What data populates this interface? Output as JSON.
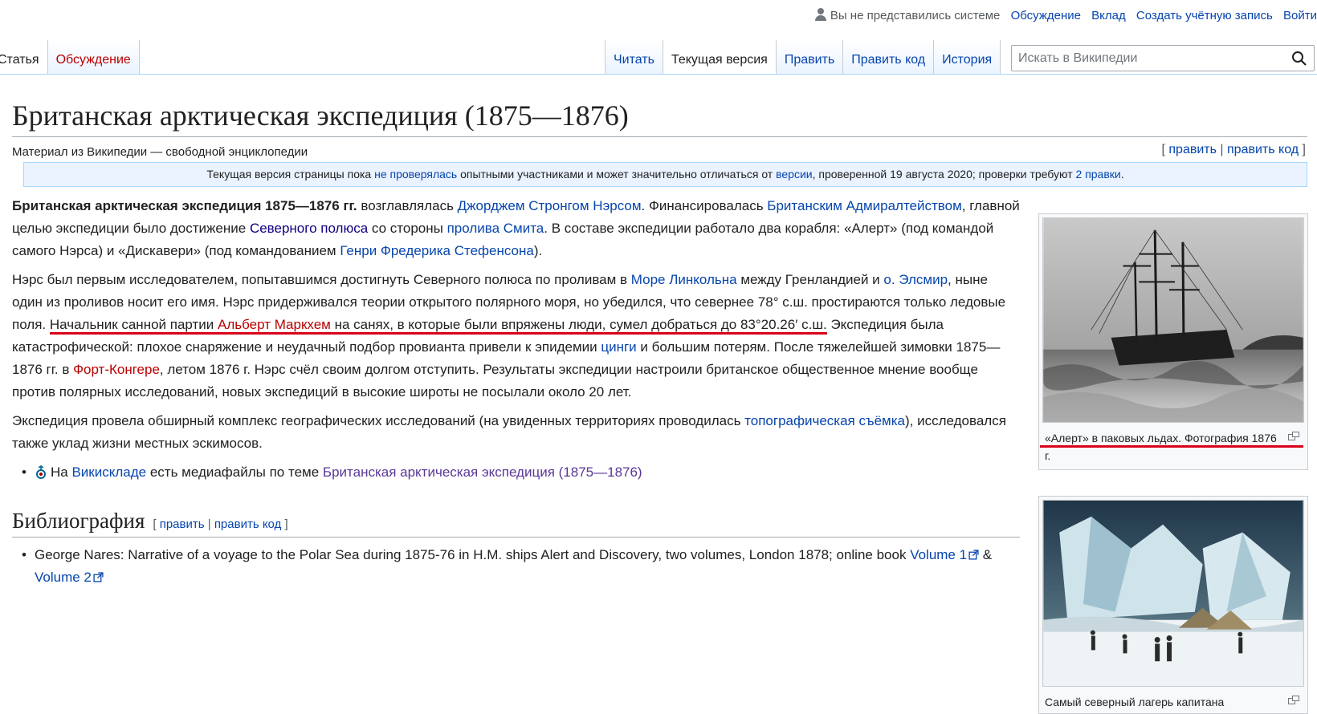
{
  "personal": {
    "anon": "Вы не представились системе",
    "talk": "Обсуждение",
    "login": "Вклад",
    "create": "Создать учётную запись",
    "enter": "Войти"
  },
  "tabs": {
    "article": "Статья",
    "discussion": "Обсуждение",
    "read": "Читать",
    "current": "Текущая версия",
    "edit": "Править",
    "edit_code": "Править код",
    "history": "История"
  },
  "search": {
    "placeholder": "Искать в Википедии"
  },
  "page": {
    "title": "Британская арктическая экспедиция (1875—1876)",
    "tagline": "Материал из Википедии — свободной энциклопедии",
    "edit": "править",
    "edit_code": "править код",
    "bracket_open": "[",
    "bracket_close": "]",
    "sep": "|"
  },
  "notice": {
    "t1": "Текущая версия страницы пока ",
    "l1": "не проверялась",
    "t2": " опытными участниками и может значительно отличаться от ",
    "l2": "версии",
    "t3": ", проверенной 19 августа 2020; проверки требуют ",
    "l3": "2 правки",
    "t4": "."
  },
  "p1": {
    "bold": "Британская арктическая экспедиция 1875—1876 гг.",
    "t1": " возглавлялась ",
    "l1": "Джорджем Стронгом Нэрсом",
    "t2": ". Финансировалась ",
    "l2": "Британским Адмиралтейством",
    "t3": ", главной целью экспедиции было достижение ",
    "l3": "Северного полюса",
    "t4": " со стороны ",
    "l4": "пролива Смита",
    "t5": ". В составе экспедиции работало два корабля: «Алерт» (под командой самого Нэрса) и «Дискавери» (под командованием ",
    "l5": "Генри Фредерика Стефенсона",
    "t6": ")."
  },
  "p2": {
    "t1": "Нэрс был первым исследователем, попытавшимся достигнуть Северного полюса по проливам в ",
    "l1": "Море Линкольна",
    "t2": " между Гренландией и ",
    "l2": "о. Элсмир",
    "t3": ", ныне один из проливов носит его имя. Нэрс придерживался теории открытого полярного моря, но убедился, что севернее 78° с.ш. простираются только ледовые поля. ",
    "u1": "Начальник санной партии ",
    "l3": "Альберт Маркхем",
    "u2": " на санях, в которые были впряжены люди, сумел добраться до 83°20.26′ с.ш.",
    "t4": " Экспедиция была катастрофической: плохое снаряжение и неудачный подбор провианта привели к эпидемии ",
    "l4": "цинги",
    "t5": " и большим потерям. После тяжелейшей зимовки 1875—1876 гг. в ",
    "l5": "Форт-Конгере",
    "t6": ", летом 1876 г. Нэрс счёл своим долгом отступить. Результаты экспедиции настроили британское общественное мнение вообще против полярных исследований, новых экспедиций в высокие широты не посылали около 20 лет."
  },
  "p3": {
    "t1": "Экспедиция провела обширный комплекс географических исследований (на увиденных территориях проводилась ",
    "l1": "топографическая съёмка",
    "t2": "), исследовался также уклад жизни местных эскимосов."
  },
  "commons": {
    "t1": "На ",
    "l1": "Викискладе",
    "t2": " есть медиафайлы по теме ",
    "l2": "Британская арктическая экспедиция (1875—1876)"
  },
  "bib": {
    "heading": "Библиография",
    "t1": "George Nares: Narrative of a voyage to the Polar Sea during 1875-76 in H.M. ships Alert and Discovery, two volumes, London 1878; online book ",
    "l1": "Volume 1",
    "t2": " & ",
    "l2": "Volume 2"
  },
  "thumb1": {
    "caption": "«Алерт» в паковых льдах. Фотография 1876 г."
  },
  "thumb2": {
    "caption": "Самый северный лагерь капитана"
  }
}
